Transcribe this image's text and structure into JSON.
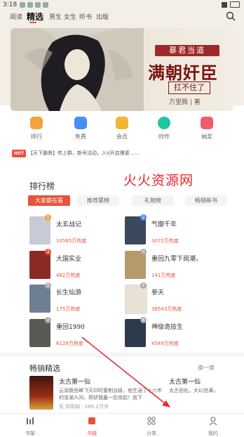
{
  "status": {
    "time": "3:18"
  },
  "topnav": {
    "tabs": [
      "阅读",
      "精选",
      "男生",
      "女生",
      "听书",
      "出版"
    ],
    "active": "精选"
  },
  "banner": {
    "subtitle": "暴君当道",
    "title": "满朝奸臣",
    "tag": "扛不住了",
    "author": "万里腾 | 著"
  },
  "quicknav": [
    {
      "label": "排行",
      "icon": "trophy-icon",
      "color": "#f2a33a"
    },
    {
      "label": "免费",
      "icon": "book-icon",
      "color": "#4a8ef0"
    },
    {
      "label": "会员",
      "icon": "crown-icon",
      "color": "#f2b632"
    },
    {
      "label": "时作",
      "icon": "heart-icon",
      "color": "#22c4a4"
    },
    {
      "label": "抽奖",
      "icon": "gift-icon",
      "color": "#f25c6a"
    }
  ],
  "ticker": {
    "badge": "HOT",
    "text": "【天下霸骨】传上群，新号活动，入V开启爆更……"
  },
  "ranking": {
    "title": "排行榜",
    "tabs": [
      "大家都在看",
      "推荐票榜",
      "礼物榜",
      "畅销新书"
    ],
    "active_tab": "大家都在看",
    "books": [
      {
        "rank": "1",
        "name": "太玄战记",
        "popularity": "10565万热度",
        "cover": "#c7cbd6"
      },
      {
        "rank": "2",
        "name": "气御千年",
        "popularity": "3072万热度",
        "cover": "#3a4a5c"
      },
      {
        "rank": "3",
        "name": "大国实业",
        "popularity": "482万热度",
        "cover": "#8a2b24"
      },
      {
        "rank": "4",
        "name": "重回九零下岗潮，",
        "popularity": "141万热度",
        "cover": "#b59a6b"
      },
      {
        "rank": "5",
        "name": "长生仙游",
        "popularity": "175万热度",
        "cover": "#6f7f93"
      },
      {
        "rank": "6",
        "name": "参天",
        "popularity": "38543万热度",
        "cover": "#e8e2d6"
      },
      {
        "rank": "7",
        "name": "重回1990",
        "popularity": "6129万热度",
        "cover": "#5b5a52"
      },
      {
        "rank": "8",
        "name": "神级诡技生",
        "popularity": "4549万热度",
        "cover": "#2d3a4d"
      }
    ]
  },
  "watermark": "火火资源网",
  "bestseller": {
    "title": "畅销精选",
    "more": "换一换",
    "book1": {
      "name": "太古第一仙",
      "desc": "云润我岳峰飞天印时童制派级，他生涵了十六年的洛湖人间，预状我鑫一应攻起！放下",
      "meta": "玄 凤鸣和 · 285.2万字"
    },
    "book2": {
      "name": "太古第一仙",
      "desc": "太古创化，大幻沧满，"
    }
  },
  "bottomnav": [
    {
      "label": "书架",
      "icon": "shelf-icon"
    },
    {
      "label": "书城",
      "icon": "store-icon"
    },
    {
      "label": "分类",
      "icon": "category-icon"
    },
    {
      "label": "我的",
      "icon": "profile-icon"
    }
  ],
  "colors": {
    "accent": "#e8533a",
    "banner_text": "#7a1414"
  }
}
